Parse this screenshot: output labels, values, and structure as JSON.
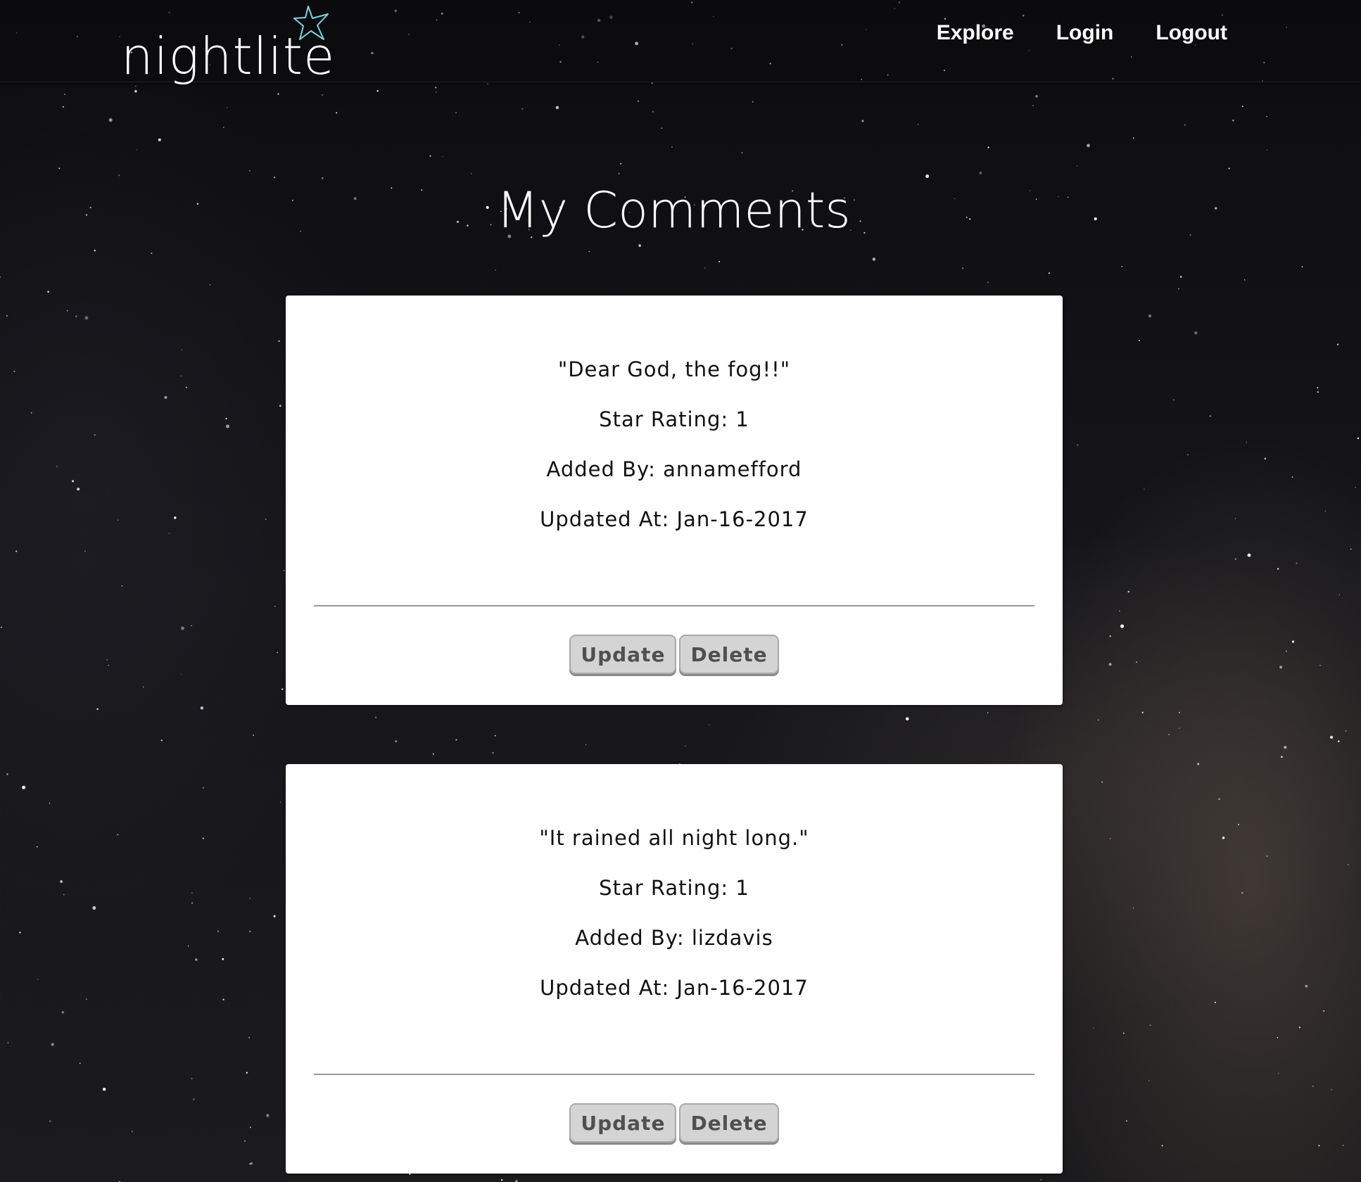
{
  "brand": {
    "name": "nightlite",
    "icon": "star-outline-icon",
    "icon_color": "#7fd3e0"
  },
  "nav": {
    "items": [
      {
        "label": "Explore"
      },
      {
        "label": "Login"
      },
      {
        "label": "Logout"
      }
    ]
  },
  "page": {
    "title": "My Comments"
  },
  "comments": [
    {
      "text": "\"Dear God, the fog!!\"",
      "star_rating": "Star Rating: 1",
      "added_by": "Added By: annamefford",
      "updated_at": "Updated At: Jan-16-2017",
      "update_label": "Update",
      "delete_label": "Delete"
    },
    {
      "text": "\"It rained all night long.\"",
      "star_rating": "Star Rating: 1",
      "added_by": "Added By: lizdavis",
      "updated_at": "Updated At: Jan-16-2017",
      "update_label": "Update",
      "delete_label": "Delete"
    }
  ],
  "colors": {
    "card_background": "#ffffff",
    "button_background": "#d4d4d4",
    "button_text": "#505050",
    "nav_text": "#ffffff"
  }
}
